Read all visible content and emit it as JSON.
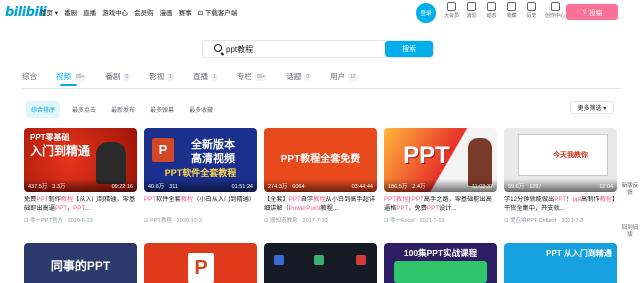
{
  "nav": {
    "logo": "bilibili",
    "links": [
      "首页 ▾",
      "番剧",
      "直播",
      "游戏中心",
      "会员购",
      "漫画",
      "赛事",
      "下载客户端"
    ],
    "login": "登录",
    "icons": [
      {
        "name": "vip-icon",
        "label": "大会员"
      },
      {
        "name": "message-icon",
        "label": "消息"
      },
      {
        "name": "dynamic-icon",
        "label": "动态"
      },
      {
        "name": "favorite-icon",
        "label": "收藏"
      },
      {
        "name": "history-icon",
        "label": "历史"
      },
      {
        "name": "creator-icon",
        "label": "创作中心"
      }
    ],
    "upload": "投稿"
  },
  "search": {
    "value": "ppt教程",
    "button": "搜索"
  },
  "tabs": [
    {
      "label": "综合",
      "count": ""
    },
    {
      "label": "视频",
      "count": "99+"
    },
    {
      "label": "番剧",
      "count": "0"
    },
    {
      "label": "影视",
      "count": "1"
    },
    {
      "label": "直播",
      "count": "1"
    },
    {
      "label": "专栏",
      "count": "99+"
    },
    {
      "label": "话题",
      "count": "0"
    },
    {
      "label": "用户",
      "count": "12"
    }
  ],
  "sorts": [
    "综合排序",
    "最多点击",
    "最新发布",
    "最多弹幕",
    "最多收藏"
  ],
  "filter": "更多筛选 ▾",
  "cards": [
    {
      "thumb_lines": [
        "PPT零基础",
        "入门到精通"
      ],
      "plays": "437.5万",
      "danmaku": "3.3万",
      "duration": "09:22:16",
      "title_parts": [
        "免费",
        "PPT",
        "制作",
        "教程",
        "【从入门到精通，零基础即出高逼",
        "PPT",
        "，",
        "PPT",
        "..."
      ],
      "author": "⊡ 零一PPT官方 · 2020-6-23"
    },
    {
      "thumb_lines": [
        "全新版本",
        "高清视频",
        "PPT软件全套教程"
      ],
      "plays": "40.6万",
      "danmaku": "311",
      "duration": "01:51:24",
      "title_parts": [
        "PPT",
        "软件全套",
        "教程",
        "（小白从入门到精通）"
      ],
      "author": "⊡ PPT教程 · 2020-12-3"
    },
    {
      "thumb_lines": [
        "PPT教程全套免费"
      ],
      "plays": "274.3万",
      "danmaku": "6064",
      "duration": "03:44:44",
      "title_parts": [
        "【全套】",
        "PPT",
        "自学",
        "教程",
        "从小白到高手超详细讲解（",
        "PowerPoint",
        "教程..."
      ],
      "author": "⊡ 顺知道教育 · 2017-7-10"
    },
    {
      "thumb_lines": [
        "PPT"
      ],
      "plays": "186.5万",
      "danmaku": "2.4万",
      "duration": "11:03:37",
      "title_parts": [
        "PPT",
        "教程",
        "| ",
        "PPT",
        "高手之路，零基础能出高逼格",
        "PPT",
        "，免费",
        "PPT",
        "设计..."
      ],
      "author": "⊡ 零一Excel · 2021-7-19"
    },
    {
      "thumb_lines": [
        "今天我教你"
      ],
      "plays": "59.6万",
      "danmaku": "1297",
      "duration": "12:04",
      "title_parts": [
        "学12分钟就能做出",
        "PPT",
        "！",
        "ppt",
        "高制作",
        "教程",
        "】干货全集中，开支就..."
      ],
      "author": "⊡ 爱召唤PPT-Delbert · 2021-7-8"
    }
  ],
  "bottom_thumbs": [
    {
      "text": "同事的PPT"
    },
    {
      "text": "P"
    },
    {
      "text": ""
    },
    {
      "text": "100集PPT实战课程"
    },
    {
      "text": "PPT 从入门到精通"
    }
  ],
  "side": [
    {
      "label": "新版反馈"
    },
    {
      "label": "回到旧版"
    }
  ]
}
